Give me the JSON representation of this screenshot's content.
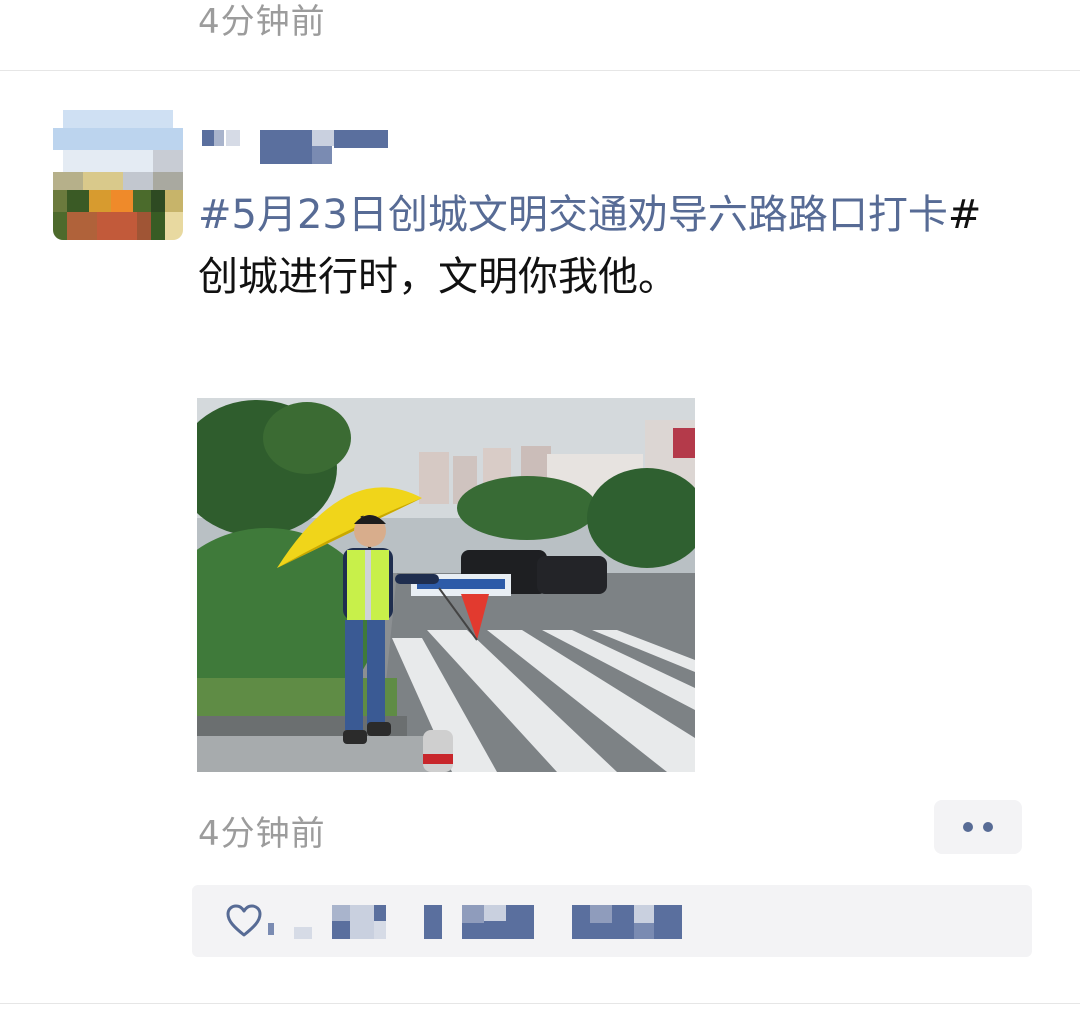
{
  "previous_post": {
    "timestamp": "4分钟前"
  },
  "post": {
    "author": {
      "name": ""
    },
    "topic": "#5月23日创城文明交通劝导六路路口打卡",
    "topic_end": "#",
    "body": "创城进行时，文明你我他。",
    "image": {
      "icon": "photo-icon"
    },
    "timestamp": "4分钟前",
    "more_icon": "more-dots-icon",
    "likes": {
      "icon": "heart-icon",
      "names": ""
    }
  },
  "colors": {
    "link": "#576b95",
    "secondary_text": "#9c9c9c",
    "panel_bg": "#f3f3f5",
    "text": "#111111"
  }
}
